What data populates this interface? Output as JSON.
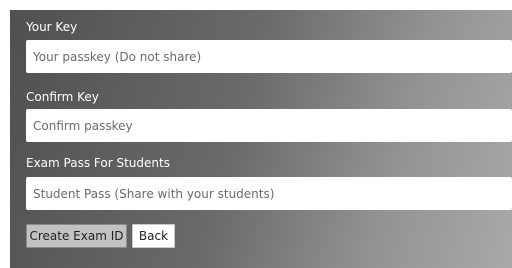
{
  "form": {
    "your_key": {
      "label": "Your Key",
      "placeholder": "Your passkey (Do not share)",
      "value": ""
    },
    "confirm_key": {
      "label": "Confirm Key",
      "placeholder": "Confirm passkey",
      "value": ""
    },
    "exam_pass": {
      "label": "Exam Pass For Students",
      "placeholder": "Student Pass (Share with your students)",
      "value": ""
    }
  },
  "actions": {
    "create_label": "Create Exam ID",
    "back_label": "Back"
  }
}
